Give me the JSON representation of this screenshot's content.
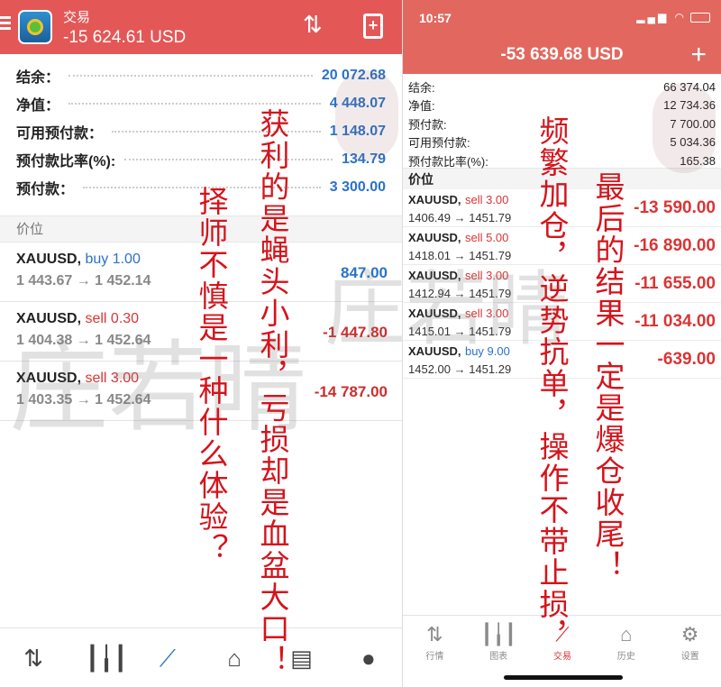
{
  "left": {
    "header": {
      "title": "交易",
      "balance": "-15 624.61 USD"
    },
    "summary": [
      {
        "label": "结余：",
        "value": "20 072.68"
      },
      {
        "label": "净值：",
        "value": "4 448.07"
      },
      {
        "label": "可用预付款：",
        "value": "1 148.07"
      },
      {
        "label": "预付款比率(%):",
        "value": "134.79"
      },
      {
        "label": "预付款：",
        "value": "3 300.00"
      }
    ],
    "section_label": "价位",
    "positions": [
      {
        "symbol": "XAUUSD,",
        "side": "buy 1.00",
        "type": "buy",
        "prices": "1 443.67 → 1 452.14",
        "pl": "847.00"
      },
      {
        "symbol": "XAUUSD,",
        "side": "sell 0.30",
        "type": "sell",
        "prices": "1 404.38 → 1 452.64",
        "pl": "-1 447.80"
      },
      {
        "symbol": "XAUUSD,",
        "side": "sell 3.00",
        "type": "sell",
        "prices": "1 403.35 → 1 452.64",
        "pl": "-14 787.00"
      }
    ],
    "nav_icons": [
      "quotes-icon",
      "chart-icon",
      "trade-icon",
      "history-icon",
      "news-icon",
      "chat-icon"
    ]
  },
  "right": {
    "status": {
      "time": "10:57"
    },
    "header": {
      "balance": "-53 639.68 USD",
      "plus": "+"
    },
    "summary": [
      {
        "label": "结余:",
        "value": "66 374.04"
      },
      {
        "label": "净值:",
        "value": "12 734.36"
      },
      {
        "label": "预付款:",
        "value": "7 700.00"
      },
      {
        "label": "可用预付款:",
        "value": "5 034.36"
      },
      {
        "label": "预付款比率(%):",
        "value": "165.38"
      }
    ],
    "section_label": "价位",
    "positions": [
      {
        "symbol": "XAUUSD,",
        "side": "sell 3.00",
        "type": "sell",
        "prices": "1406.49 → 1451.79",
        "pl": "-13 590.00"
      },
      {
        "symbol": "XAUUSD,",
        "side": "sell 5.00",
        "type": "sell",
        "prices": "1418.01 → 1451.79",
        "pl": "-16 890.00"
      },
      {
        "symbol": "XAUUSD,",
        "side": "sell 3.00",
        "type": "sell",
        "prices": "1412.94 → 1451.79",
        "pl": "-11 655.00"
      },
      {
        "symbol": "XAUUSD,",
        "side": "sell 3.00",
        "type": "sell",
        "prices": "1415.01 → 1451.79",
        "pl": "-11 034.00"
      },
      {
        "symbol": "XAUUSD,",
        "side": "buy 9.00",
        "type": "buy",
        "prices": "1452.00 → 1451.29",
        "pl": "-639.00"
      }
    ],
    "nav": [
      {
        "label": "行情",
        "icon": "quotes-icon"
      },
      {
        "label": "图表",
        "icon": "chart-icon"
      },
      {
        "label": "交易",
        "icon": "trade-icon"
      },
      {
        "label": "历史",
        "icon": "history-icon"
      },
      {
        "label": "设置",
        "icon": "settings-icon"
      }
    ]
  },
  "annotations": {
    "a1": "择师不慎是一种什么体验？",
    "a2": "获利的是蝇头小利，亏损却是血盆大口！",
    "a3": "频繁加仓，逆势抗单，操作不带止损，",
    "a4": "最后的结果一定是爆仓收尾！"
  },
  "watermark": {
    "text": "庄若晴"
  },
  "colors": {
    "header_left": "#e45757",
    "header_right": "#e2685f",
    "buy": "#2a72c9",
    "sell": "#d93535",
    "annotation": "#d4141c"
  }
}
